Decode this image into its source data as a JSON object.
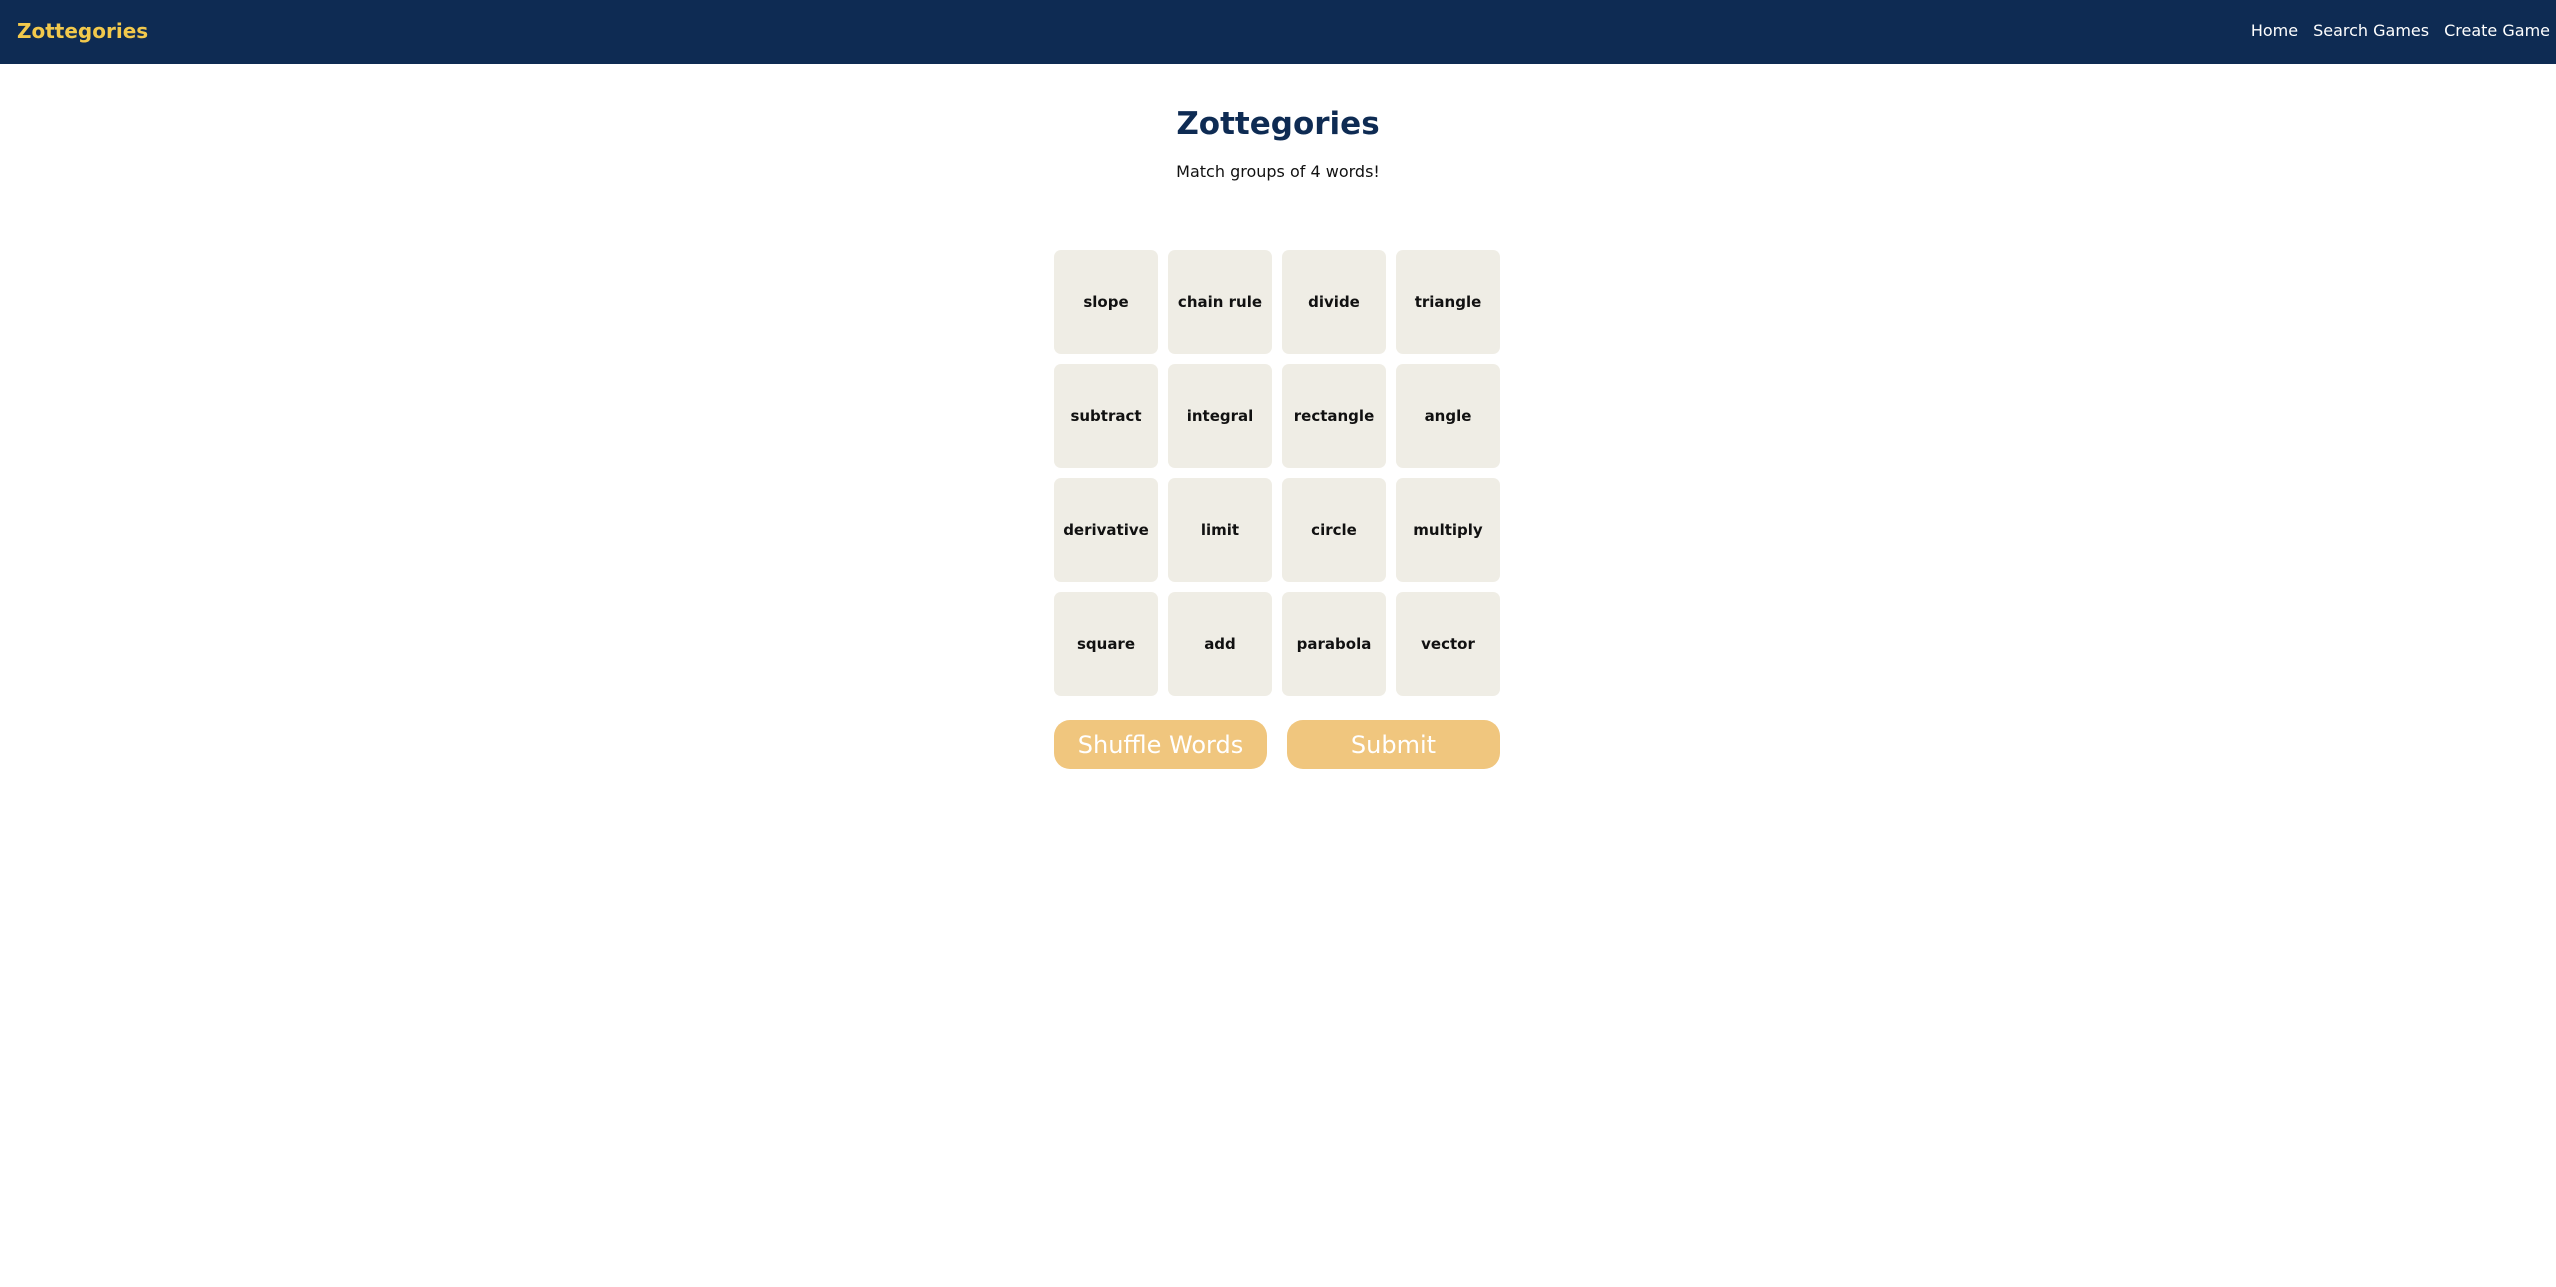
{
  "navbar": {
    "brand": "Zottegories",
    "links": [
      "Home",
      "Search Games",
      "Create Game"
    ]
  },
  "game": {
    "title": "Zottegories",
    "subtitle": "Match groups of 4 words!",
    "words": [
      "slope",
      "chain rule",
      "divide",
      "triangle",
      "subtract",
      "integral",
      "rectangle",
      "angle",
      "derivative",
      "limit",
      "circle",
      "multiply",
      "square",
      "add",
      "parabola",
      "vector"
    ],
    "buttons": {
      "shuffle": "Shuffle Words",
      "submit": "Submit"
    }
  },
  "colors": {
    "navbar": "#0e2b53",
    "brand": "#f2c94c",
    "tile": "#efede5",
    "button": "#f0c67e"
  }
}
